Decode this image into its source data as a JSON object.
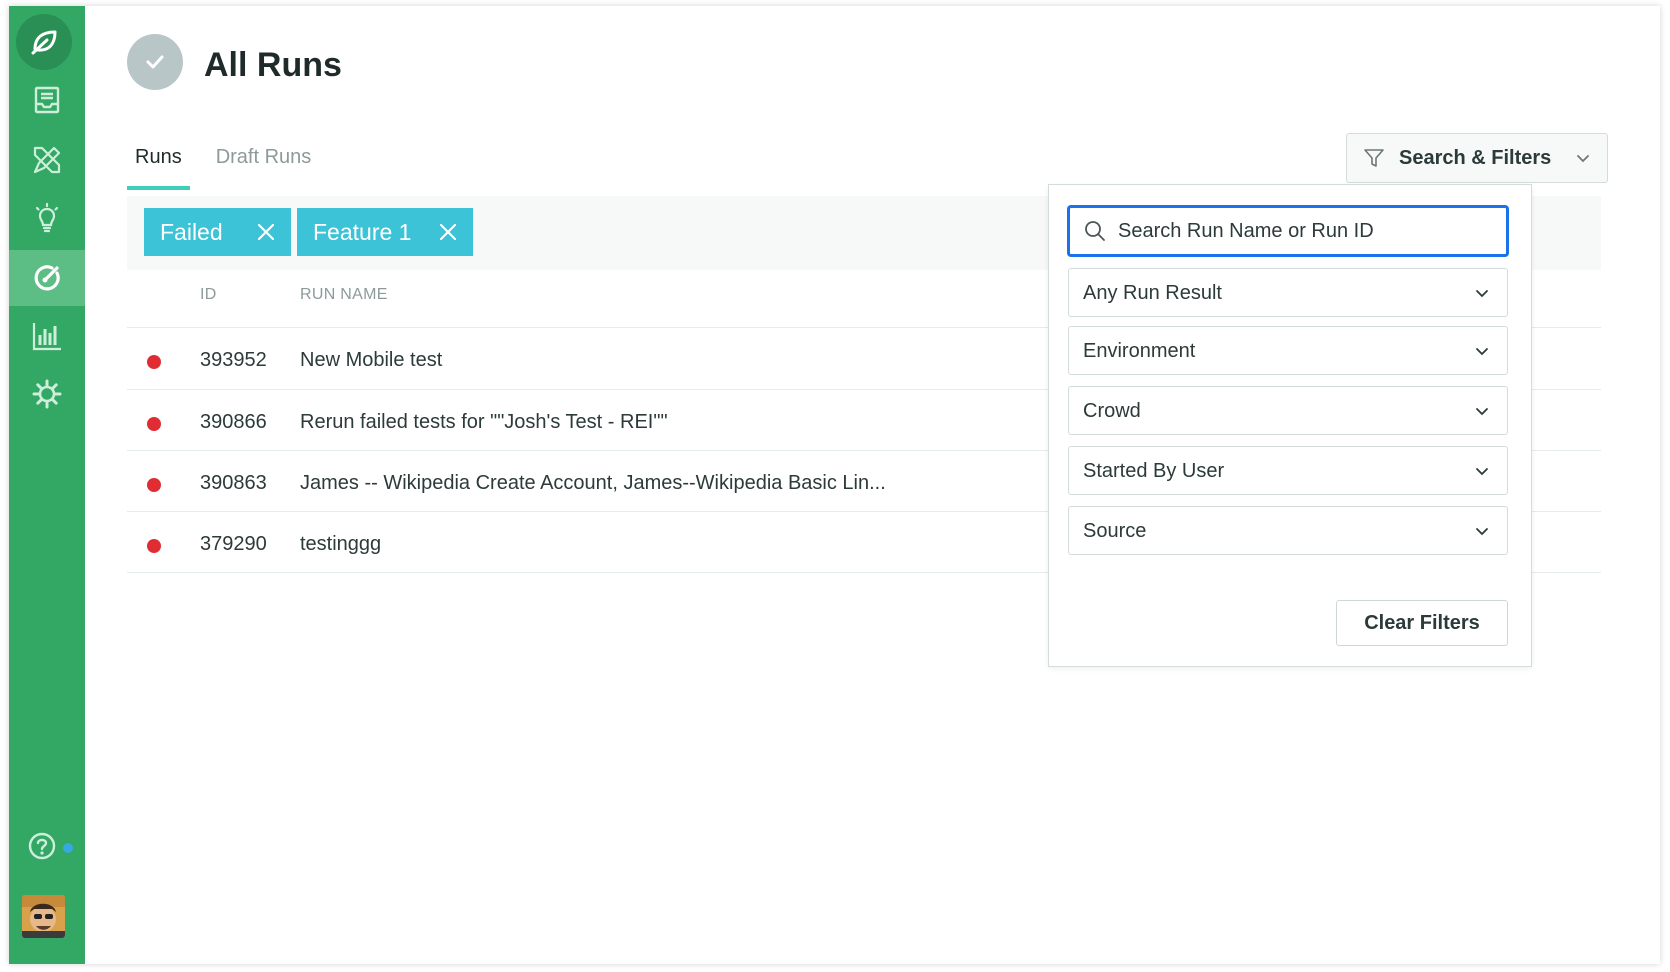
{
  "page": {
    "title": "All Runs"
  },
  "tabs": [
    {
      "label": "Runs",
      "active": true
    },
    {
      "label": "Draft Runs",
      "active": false
    }
  ],
  "search_button": {
    "label": "Search & Filters",
    "icon": "filter-icon"
  },
  "active_filters": [
    {
      "label": "Failed"
    },
    {
      "label": "Feature 1"
    }
  ],
  "table": {
    "columns": [
      "ID",
      "RUN NAME"
    ],
    "rows": [
      {
        "status": "failed",
        "id": "393952",
        "name": "New Mobile test"
      },
      {
        "status": "failed",
        "id": "390866",
        "name": "Rerun failed tests for \"\"Josh's Test - REI\"\""
      },
      {
        "status": "failed",
        "id": "390863",
        "name": "James -- Wikipedia Create Account, James--Wikipedia Basic Lin..."
      },
      {
        "status": "failed",
        "id": "379290",
        "name": "testinggg"
      }
    ]
  },
  "filter_panel": {
    "search_placeholder": "Search Run Name or Run ID",
    "selects": [
      {
        "value": "Any Run Result"
      },
      {
        "value": "Environment"
      },
      {
        "value": "Crowd"
      },
      {
        "value": "Started By User"
      },
      {
        "value": "Source"
      }
    ],
    "clear_label": "Clear Filters"
  },
  "sidebar": {
    "items": [
      {
        "icon": "inbox-icon"
      },
      {
        "icon": "design-tools-icon"
      },
      {
        "icon": "lightbulb-icon"
      },
      {
        "icon": "runs-gauge-icon",
        "active": true
      },
      {
        "icon": "bar-chart-icon"
      },
      {
        "icon": "gear-icon"
      }
    ]
  },
  "colors": {
    "sidebar": "#33a864",
    "accent_tab": "#3fcfb8",
    "chip": "#3cc3d7",
    "failed": "#e02d33",
    "focus": "#1a73e8"
  }
}
